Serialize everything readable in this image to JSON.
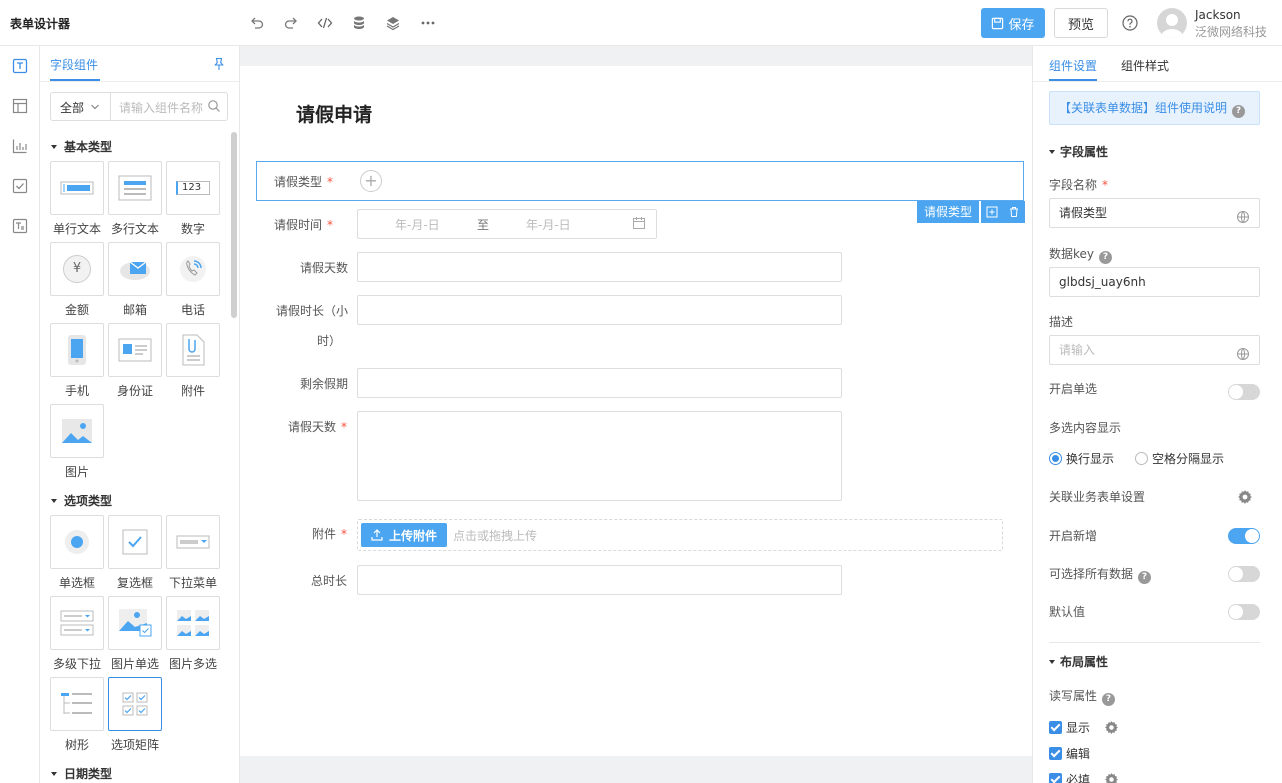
{
  "app": {
    "title": "表单设计器"
  },
  "toolbar": {
    "save_label": "保存",
    "preview_label": "预览"
  },
  "user": {
    "name": "Jackson",
    "org": "泛微网络科技"
  },
  "left_panel": {
    "tab": "字段组件",
    "filter": {
      "selected": "全部",
      "placeholder": "请输入组件名称"
    },
    "categories": [
      {
        "name": "基本类型",
        "items": [
          "单行文本",
          "多行文本",
          "数字",
          "金额",
          "邮箱",
          "电话",
          "手机",
          "身份证",
          "附件",
          "图片"
        ]
      },
      {
        "name": "选项类型",
        "items": [
          "单选框",
          "复选框",
          "下拉菜单",
          "多级下拉",
          "图片单选",
          "图片多选",
          "树形",
          "选项矩阵"
        ]
      },
      {
        "name": "日期类型",
        "items": []
      }
    ],
    "number_icon_text": "123",
    "currency_icon_text": "¥"
  },
  "form": {
    "title": "请假申请",
    "fields": [
      {
        "label": "请假类型",
        "required": true
      },
      {
        "label": "请假时间",
        "required": true,
        "start_placeholder": "年-月-日",
        "separator": "至",
        "end_placeholder": "年-月-日"
      },
      {
        "label": "请假天数",
        "required": false
      },
      {
        "label_line1": "请假时长（小",
        "label_line2": "时）",
        "required": false
      },
      {
        "label": "剩余假期",
        "required": false
      },
      {
        "label": "请假天数",
        "required": true
      },
      {
        "label": "附件",
        "required": true,
        "upload_label": "上传附件",
        "upload_hint": "点击或拖拽上传"
      },
      {
        "label": "总时长",
        "required": false
      }
    ],
    "selected_tag": "请假类型",
    "required_mark": "*"
  },
  "right_panel": {
    "tabs": [
      "组件设置",
      "组件样式"
    ],
    "banner": "【关联表单数据】组件使用说明",
    "field_section": "字段属性",
    "field_name_label": "字段名称",
    "field_name_value": "请假类型",
    "data_key_label": "数据key",
    "data_key_value": "glbdsj_uay6nh",
    "desc_label": "描述",
    "desc_placeholder": "请输入",
    "single_select_label": "开启单选",
    "multi_display_label": "多选内容显示",
    "radio_options": [
      "换行显示",
      "空格分隔显示"
    ],
    "related_settings_label": "关联业务表单设置",
    "enable_add_label": "开启新增",
    "select_all_label": "可选择所有数据",
    "default_label": "默认值",
    "layout_section": "布局属性",
    "rw_label": "读写属性",
    "checkboxes": [
      "显示",
      "编辑",
      "必填"
    ],
    "toggles": {
      "single_select": false,
      "enable_add": true,
      "select_all": false,
      "default": false
    },
    "help_mark": "?"
  },
  "colors": {
    "accent": "#4ba5f0",
    "required": "#f5533d"
  }
}
